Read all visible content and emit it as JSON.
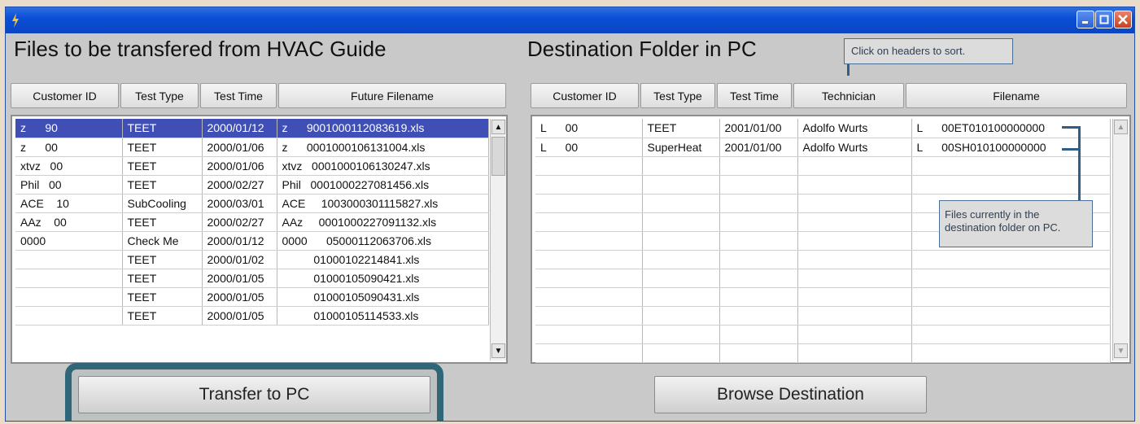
{
  "window": {
    "title_icon": "lightning-bolt-icon",
    "controls": [
      "minimize-icon",
      "maximize-icon",
      "close-icon"
    ]
  },
  "tooltips": {
    "sort": "Click on headers to sort.",
    "files_line1": "Files currently in the",
    "files_line2": "destination folder on PC."
  },
  "left_panel": {
    "title": "Files to be transfered from HVAC Guide",
    "columns": [
      "Customer ID",
      "Test Type",
      "Test Time",
      "Future Filename"
    ],
    "selected_row": 0,
    "rows": [
      [
        "z      90",
        "TEET",
        "2000/01/12",
        "z      9001000112083619.xls"
      ],
      [
        "z      00",
        "TEET",
        "2000/01/06",
        "z      0001000106131004.xls"
      ],
      [
        "xtvz   00",
        "TEET",
        "2000/01/06",
        "xtvz   0001000106130247.xls"
      ],
      [
        "Phil   00",
        "TEET",
        "2000/02/27",
        "Phil   0001000227081456.xls"
      ],
      [
        "ACE    10",
        "SubCooling",
        "2000/03/01",
        "ACE     1003000301115827.xls"
      ],
      [
        "AAz    00",
        "TEET",
        "2000/02/27",
        "AAz     0001000227091132.xls"
      ],
      [
        "0000",
        "Check Me",
        "2000/01/12",
        "0000      05000112063706.xls"
      ],
      [
        "",
        "TEET",
        "2000/01/02",
        "          01000102214841.xls"
      ],
      [
        "",
        "TEET",
        "2000/01/05",
        "          01000105090421.xls"
      ],
      [
        "",
        "TEET",
        "2000/01/05",
        "          01000105090431.xls"
      ],
      [
        "",
        "TEET",
        "2000/01/05",
        "          01000105114533.xls"
      ]
    ],
    "button": "Transfer  to  PC"
  },
  "right_panel": {
    "title": "Destination Folder in PC",
    "columns": [
      "Customer ID",
      "Test Type",
      "Test Time",
      "Technician",
      "Filename"
    ],
    "rows": [
      [
        "L      00",
        "TEET",
        "2001/01/00",
        "Adolfo Wurts",
        "L      00ET010100000000"
      ],
      [
        "L      00",
        "SuperHeat",
        "2001/01/00",
        "Adolfo Wurts",
        "L      00SH010100000000"
      ]
    ],
    "empty_rows": 11,
    "button": "Browse  Destination"
  },
  "scroll_arrows": {
    "up": "▲",
    "down": "▼"
  }
}
